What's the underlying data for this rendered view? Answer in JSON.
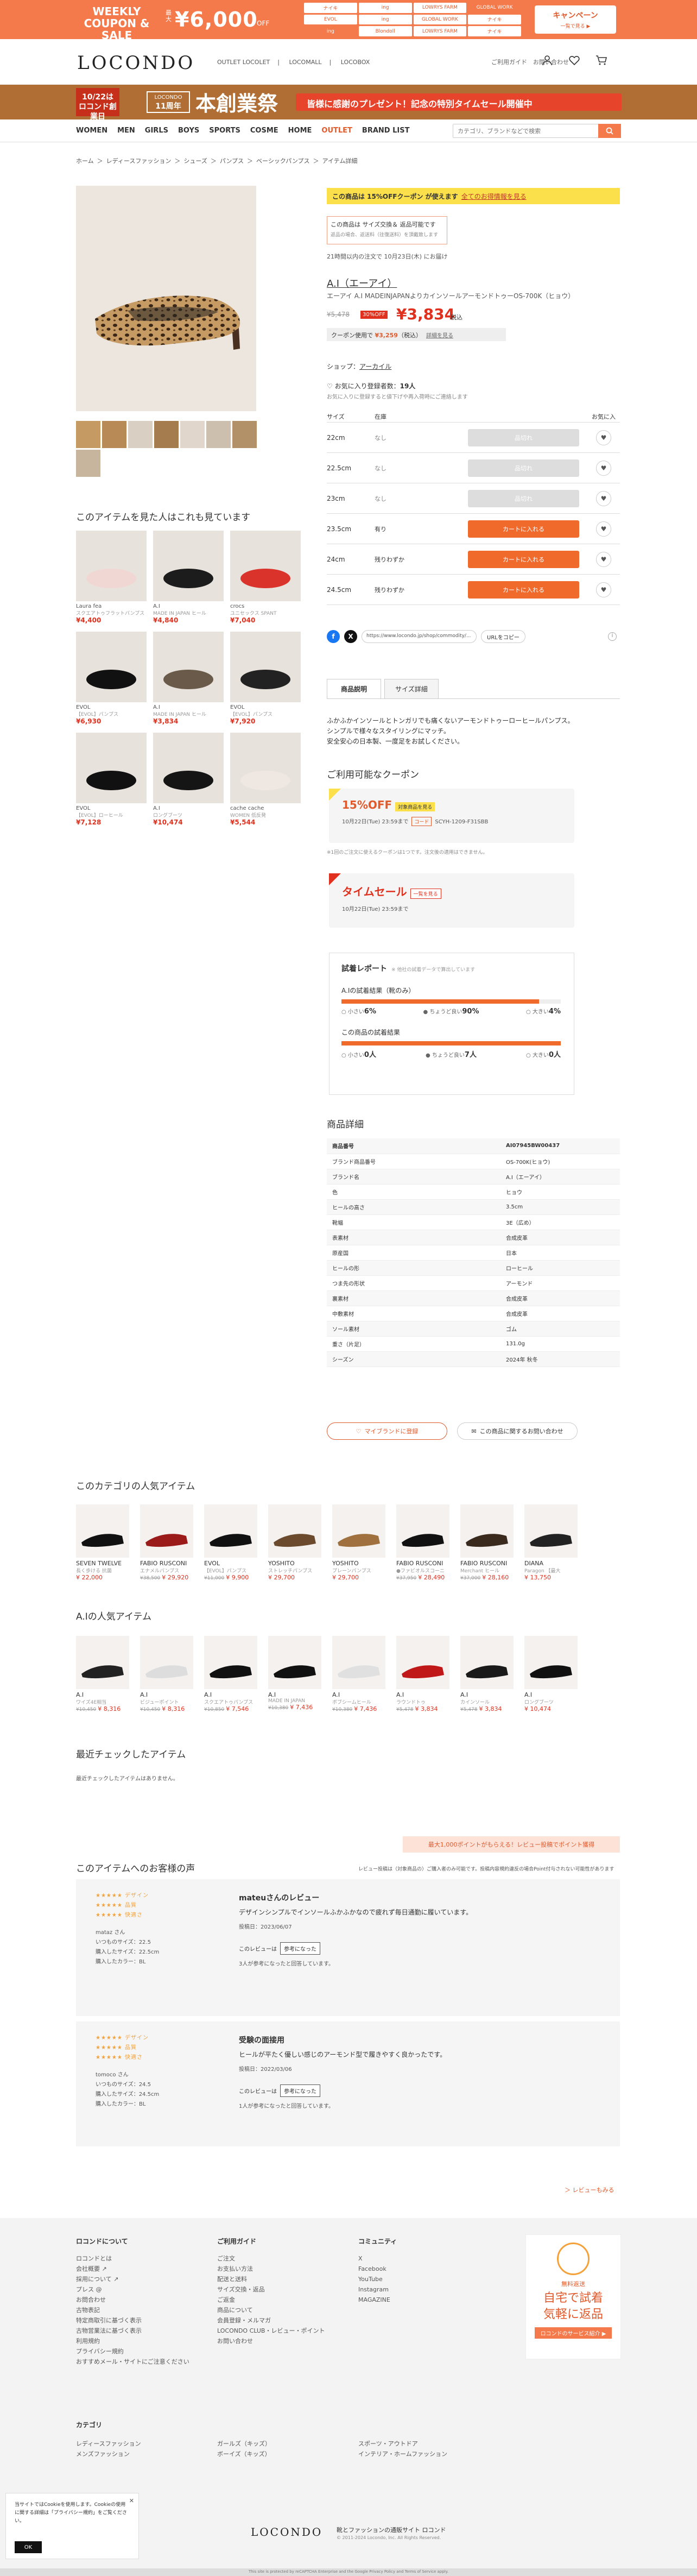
{
  "promo": {
    "weekly": "WEEKLY",
    "coupon_sale": "COUPON & SALE",
    "max": "最大",
    "amount": "¥6,000",
    "off": "OFF",
    "grid": [
      "ナイキ",
      "ing",
      "LOWRYS FARM",
      "GLOBAL WORK",
      "EVOL",
      "ing",
      "GLOBAL WORK",
      "ナイキ",
      "ing",
      "Blondoll",
      "LOWRYS FARM",
      "ナイキ"
    ],
    "campaign_label": "キャンペーン",
    "campaign_period": "一覧で見る ▶"
  },
  "header": {
    "logo": "LOCONDO",
    "sublinks": [
      "OUTLET LOCOLET",
      "LOCOMALL",
      "LOCOBOX"
    ],
    "help": "ご利用ガイド　お問い合わせ"
  },
  "banner": {
    "left_line1": "10/22は",
    "left_line2": "ロコンド創業日",
    "anniv_small": "LOCONDO",
    "anniv": "11周年",
    "title": "本創業祭",
    "message": "皆様に感謝のプレゼント！記念の特別タイムセール開催中"
  },
  "nav": {
    "items": [
      "WOMEN",
      "MEN",
      "GIRLS",
      "BOYS",
      "SPORTS",
      "COSME",
      "HOME",
      "OUTLET",
      "BRAND LIST"
    ],
    "search_placeholder": "カテゴリ、ブランドなどで検索"
  },
  "breadcrumb": [
    "ホーム",
    "＞",
    "レディースファッション",
    "＞",
    "シューズ",
    "＞",
    "パンプス",
    "＞",
    "ベーシックパンプス",
    "＞",
    "アイテム詳細"
  ],
  "recommend": {
    "title": "このアイテムを見た人はこれも見ています",
    "items": [
      {
        "brand": "Laura fea",
        "name": "スクエアトゥフラットパンプス",
        "price": "¥4,400"
      },
      {
        "brand": "A.I",
        "name": "MADE IN JAPAN ヒール",
        "price": "¥4,840"
      },
      {
        "brand": "crocs",
        "name": "ユニセックス SPANT",
        "price": "¥7,040"
      },
      {
        "brand": "EVOL",
        "name": "【EVOL】パンプス",
        "price": "¥6,930"
      },
      {
        "brand": "A.I",
        "name": "MADE IN JAPAN ヒール",
        "price": "¥3,834"
      },
      {
        "brand": "EVOL",
        "name": "【EVOL】パンプス",
        "price": "¥7,920"
      },
      {
        "brand": "EVOL",
        "name": "【EVOL】ローヒール",
        "price": "¥7,128"
      },
      {
        "brand": "A.I",
        "name": "ロングブーツ",
        "price": "¥10,474"
      },
      {
        "brand": "cache cache",
        "name": "WOMEN 低反発",
        "price": "¥5,544"
      }
    ]
  },
  "product": {
    "coupon_bar": "この商品は 15%OFFクーポン が使えます",
    "coupon_link": "全てのお得情報を見る",
    "ship_title": "この商品は サイズ交換＆ 返品可能です",
    "ship_note": "返品の場合、返送料（往復送料）を頂戴致します",
    "delivery": "21時間以内の注文で 10月23日(木) にお届け",
    "brand": "A.I（エーアイ）",
    "name": "エーアイ A.I MADEINJAPANよりカインソールアーモンドトゥーOS-700K（ヒョウ）",
    "old_price": "¥5,478",
    "discount": "30%OFF",
    "price": "¥3,834",
    "tax": "税込",
    "coupon2_pre": "クーポン使用で",
    "coupon2_val": "¥3,259",
    "coupon2_post": "（税込）",
    "coupon2_link": "詳細を見る",
    "shop_label": "ショップ：",
    "shop_name": "アーカイル",
    "fav_label": "お気に入り登録者数：",
    "fav_count": "19人",
    "fav_note": "お気に入りに登録すると値下げや再入荷時にご連絡します"
  },
  "sizes": {
    "headers": [
      "サイズ",
      "在庫",
      "",
      "お気に入"
    ],
    "rows": [
      {
        "size": "22cm",
        "stock": "なし",
        "button": "品切れ",
        "available": false
      },
      {
        "size": "22.5cm",
        "stock": "なし",
        "button": "品切れ",
        "available": false
      },
      {
        "size": "23cm",
        "stock": "なし",
        "button": "品切れ",
        "available": false
      },
      {
        "size": "23.5cm",
        "stock": "有り",
        "button": "カートに入れる",
        "available": true
      },
      {
        "size": "24cm",
        "stock": "残りわずか",
        "button": "カートに入れる",
        "available": true
      },
      {
        "size": "24.5cm",
        "stock": "残りわずか",
        "button": "カートに入れる",
        "available": true
      }
    ]
  },
  "share": {
    "url": "https://www.locondo.jp/shop/commodity/...",
    "copy": "URLをコピー"
  },
  "tabs": [
    "商品説明",
    "サイズ詳細"
  ],
  "description": [
    "ふかふかインソールとトンガリでも痛くないアーモンドトゥーローヒールパンプス。",
    "シンプルで様々なスタイリングにマッチ。",
    "安全安心の日本製、一度足をお試しください。"
  ],
  "coupons": {
    "title": "ご利用可能なクーポン",
    "c1_title": "15%OFF",
    "c1_tag": "対象商品を見る",
    "c1_period": "10月22日(Tue) 23:59まで",
    "c1_code_label": "コード",
    "c1_code": "SCYH-1209-F31SBB",
    "c2_title": "タイムセール",
    "c2_tag": "一覧を見る",
    "c2_period": "10月22日(Tue) 23:59まで",
    "note": "※1回のご注文に使えるクーポンは1つです。注文後の適用はできません。"
  },
  "fit": {
    "title": "試着レポート",
    "note": "※ 他社の試着データで算出しています",
    "sub1": "A.Iの試着結果（靴のみ）",
    "fill1": 0.9,
    "s1": [
      "小さい",
      "6%",
      "ちょうど良い",
      "90%",
      "大きい",
      "4%"
    ],
    "sub2": "この商品の試着結果",
    "fill2": 1.0,
    "s2": [
      "小さい",
      "0人",
      "ちょうど良い",
      "7人",
      "大きい",
      "0人"
    ]
  },
  "spec": {
    "title": "商品詳細",
    "rows": [
      [
        "商品番号",
        "AI07945BW00437"
      ],
      [
        "ブランド商品番号",
        "OS-700K(ヒョウ)"
      ],
      [
        "ブランド名",
        "A.I（エーアイ）"
      ],
      [
        "色",
        "ヒョウ"
      ],
      [
        "ヒールの高さ",
        "3.5cm"
      ],
      [
        "靴幅",
        "3E（広め）"
      ],
      [
        "表素材",
        "合成皮革"
      ],
      [
        "原産国",
        "日本"
      ],
      [
        "ヒールの形",
        "ローヒール"
      ],
      [
        "つま先の形状",
        "アーモンド"
      ],
      [
        "裏素材",
        "合成皮革"
      ],
      [
        "中敷素材",
        "合成皮革"
      ],
      [
        "ソール素材",
        "ゴム"
      ],
      [
        "重さ（片足）",
        "131.0g"
      ],
      [
        "シーズン",
        "2024年 秋冬"
      ]
    ],
    "btn1": "マイブランドに登録",
    "btn2": "この商品に関するお問い合わせ"
  },
  "popular": {
    "title": "このカテゴリの人気アイテム",
    "items": [
      {
        "brand": "SEVEN TWELVE",
        "name": "長く歩ける 抗菌",
        "old": "",
        "price": "¥ 22,000"
      },
      {
        "brand": "FABIO RUSCONI",
        "name": "エナメルパンプス",
        "old": "¥38,500",
        "price": "¥ 29,920"
      },
      {
        "brand": "EVOL",
        "name": "【EVOL】パンプス",
        "old": "¥11,000",
        "price": "¥ 9,900"
      },
      {
        "brand": "YOSHITO",
        "name": "ストレッチパンプス",
        "old": "",
        "price": "¥ 29,700"
      },
      {
        "brand": "YOSHITO",
        "name": "プレーンパンプス",
        "old": "",
        "price": "¥ 29,700"
      },
      {
        "brand": "FABIO RUSCONI",
        "name": "●ファビオルスコーニ",
        "old": "¥37,950",
        "price": "¥ 28,490"
      },
      {
        "brand": "FABIO RUSCONI",
        "name": "Merchant ヒール",
        "old": "¥37,000",
        "price": "¥ 28,160"
      },
      {
        "brand": "DIANA",
        "name": "Paragon 【最大",
        "old": "",
        "price": "¥ 13,750"
      }
    ]
  },
  "brand_popular": {
    "title": "A.Iの人気アイテム",
    "items": [
      {
        "brand": "A.I",
        "name": "ワイズ4E相当",
        "old": "¥10,450",
        "price": "¥ 8,316"
      },
      {
        "brand": "A.I",
        "name": "ビジューポイント",
        "old": "¥10,450",
        "price": "¥ 8,316"
      },
      {
        "brand": "A.I",
        "name": "スクエアトゥパンプス",
        "old": "¥10,850",
        "price": "¥ 7,546"
      },
      {
        "brand": "A.I",
        "name": "MADE IN JAPAN",
        "old": "¥10,380",
        "price": "¥ 7,436"
      },
      {
        "brand": "A.I",
        "name": "ボブシームヒール",
        "old": "¥10,380",
        "price": "¥ 7,436"
      },
      {
        "brand": "A.I",
        "name": "ラウンドトゥ",
        "old": "¥5,478",
        "price": "¥ 3,834"
      },
      {
        "brand": "A.I",
        "name": "カインソール",
        "old": "¥5,478",
        "price": "¥ 3,834"
      },
      {
        "brand": "A.I",
        "name": "ロングブーツ",
        "old": "",
        "price": "¥ 10,474"
      }
    ]
  },
  "recent": {
    "title": "最近チェックしたアイテム",
    "empty": "最近チェックしたアイテムはありません。"
  },
  "reviews": {
    "post_button": "最大1,000ポイントがもらえる！レビュー投稿でポイント獲得",
    "title": "このアイテムへのお客様の声",
    "note": "レビュー投稿は（対象商品の）ご購入者のみ可能です。投稿内容規約違反の場合Point付与されない可能性があります",
    "list": [
      {
        "stars": [
          "★★★★★ デザイン",
          "★★★★★ 品質",
          "★★★★★ 快適さ"
        ],
        "user": "mataz さん",
        "size_label": "いつものサイズ：22.5",
        "buy": "購入したサイズ：22.5cm",
        "feel": "購入したカラー：BL",
        "title": "mateuさんのレビュー",
        "text": "デザインシンプルでインソールふかふかなので疲れず毎日通勤に履いています。",
        "date": "投稿日：2023/06/07",
        "help_q": "このレビューは",
        "help_btn": "参考になった",
        "count": "3人が参考になったと回答しています。"
      },
      {
        "stars": [
          "★★★★★ デザイン",
          "★★★★★ 品質",
          "★★★★★ 快適さ"
        ],
        "user": "tomoco さん",
        "size_label": "いつものサイズ：24.5",
        "buy": "購入したサイズ：24.5cm",
        "feel": "購入したカラー：BL",
        "title": "受験の面接用",
        "text": "ヒールが平たく優しい感じのアーモンド型で履きやすく良かったです。",
        "date": "投稿日：2022/03/06",
        "help_q": "このレビューは",
        "help_btn": "参考になった",
        "count": "1人が参考になったと回答しています。"
      }
    ],
    "more": "＞ レビューもみる"
  },
  "footer": {
    "col1_title": "ロコンドについて",
    "col1": [
      "ロコンドとは",
      "会社概要 ↗",
      "採用について ↗",
      "プレス @",
      "お問合わせ",
      "古物表記",
      "特定商取引に基づく表示",
      "古物営業法に基づく表示",
      "利用規約",
      "プライバシー規約",
      "おすすめメール・サイトにご注意ください"
    ],
    "col2_title": "ご利用ガイド",
    "col2": [
      "ご注文",
      "お支払い方法",
      "配送と送料",
      "サイズ交換・返品",
      "ご返金",
      "商品について",
      "会員登録・メルマガ",
      "LOCONDO CLUB・レビュー・ポイント",
      "お問い合わせ"
    ],
    "col3_title": "コミュニティ",
    "col3": [
      "X",
      "Facebook",
      "YouTube",
      "Instagram",
      "MAGAZINE"
    ],
    "banner_small": "無料返送",
    "banner_big1": "自宅で試着",
    "banner_big2": "気軽に返品",
    "banner_link": "ロコンドのサービス紹介 ▶",
    "cat_title": "カテゴリ",
    "cats": [
      "レディースファッション",
      "メンズファッション",
      "ガールズ（キッズ）",
      "ボーイズ（キッズ）",
      "スポーツ・アウトドア",
      "インテリア・ホームファッション"
    ],
    "logo": "LOCONDO",
    "tagline": "靴とファッションの通販サイト ロコンド",
    "copy": "© 2011-2024 Locondo, Inc. All Rights Reserved.",
    "bottom": "This site is protected by reCAPTCHA Enterprise and the Google Privacy Policy and Terms of Service apply."
  },
  "cookie": {
    "text": "当サイトではCookieを使用します。Cookieの使用に関する詳細は「プライバシー規約」をご覧ください。",
    "ok": "OK"
  },
  "colors": {
    "accent": "#f47a4c",
    "price": "#e0301e",
    "yellow": "#fbe04b"
  }
}
